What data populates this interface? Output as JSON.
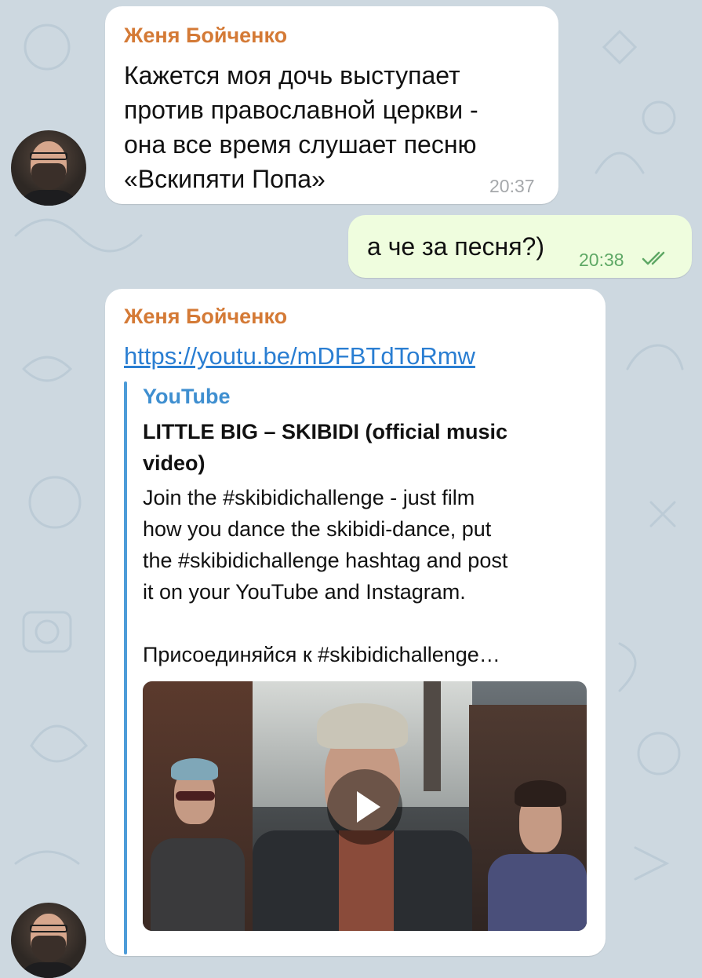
{
  "messages": [
    {
      "sender": "Женя Бойченко",
      "text": "Кажется моя дочь выступает\nпротив православной церкви -\nона все время слушает песню\n«Вскипяти Попа»",
      "time": "20:37"
    },
    {
      "text": "а че за песня?)",
      "time": "20:38",
      "status": "read-double-check-icon"
    },
    {
      "sender": "Женя Бойченко",
      "link": "https://youtu.be/mDFBTdToRmw",
      "preview": {
        "site": "YouTube",
        "title": "LITTLE BIG – SKIBIDI (official music\nvideo)",
        "description": "Join the #skibidichallenge - just film\nhow you dance the skibidi-dance, put\nthe #skibidichallenge hashtag and post\nit on your YouTube and Instagram.\n\nПрисоединяйся к #skibidichallenge…",
        "media_icon": "play-icon"
      }
    }
  ],
  "colors": {
    "background": "#cdd8e0",
    "incoming_bubble": "#ffffff",
    "outgoing_bubble": "#effdde",
    "sender_name": "#d47a36",
    "link": "#2a7ed2",
    "read_check": "#5ea865"
  }
}
